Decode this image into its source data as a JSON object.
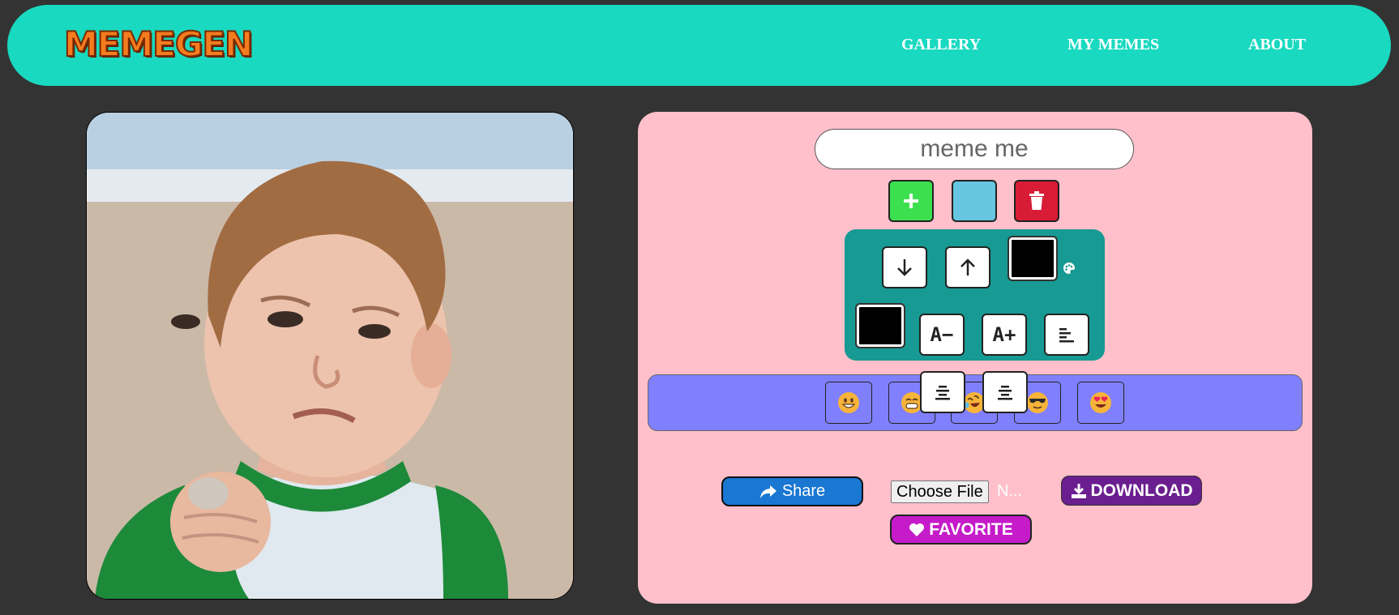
{
  "header": {
    "logo": "MEMEGEN",
    "nav": [
      "GALLERY",
      "MY MEMES",
      "ABOUT"
    ]
  },
  "editor": {
    "text_input": {
      "placeholder": "meme me",
      "value": ""
    },
    "action_icons": [
      "plus-icon",
      "color-swatch",
      "trash-icon"
    ],
    "tool_icons": [
      "arrow-down-icon",
      "arrow-up-icon",
      "palette-icon",
      "font-decrease-icon",
      "font-increase-icon",
      "align-left-icon",
      "align-center-icon",
      "align-right-icon"
    ],
    "tool_labels": {
      "font_decrease": "A−",
      "font_increase": "A+"
    },
    "emoji_icons": [
      "grinning-face",
      "beaming-face",
      "rolling-laughing-face",
      "sunglasses-face",
      "heart-eyes-face"
    ],
    "share_label": "Share",
    "file_button": "Choose File",
    "file_status": "N...",
    "download_label": "DOWNLOAD",
    "favorite_label": "FAVORITE"
  },
  "colors": {
    "header_bg": "#19d9c0",
    "editor_bg": "#ffc0cb",
    "tool_panel_bg": "#179a93",
    "emoji_bar_bg": "#8080ff",
    "add_button": "#3ce04f",
    "color_button": "#66c5e0",
    "delete_button": "#d81c36",
    "share_button": "#1a77d2",
    "download_button": "#6b1e8f",
    "favorite_button": "#c51bc9"
  }
}
